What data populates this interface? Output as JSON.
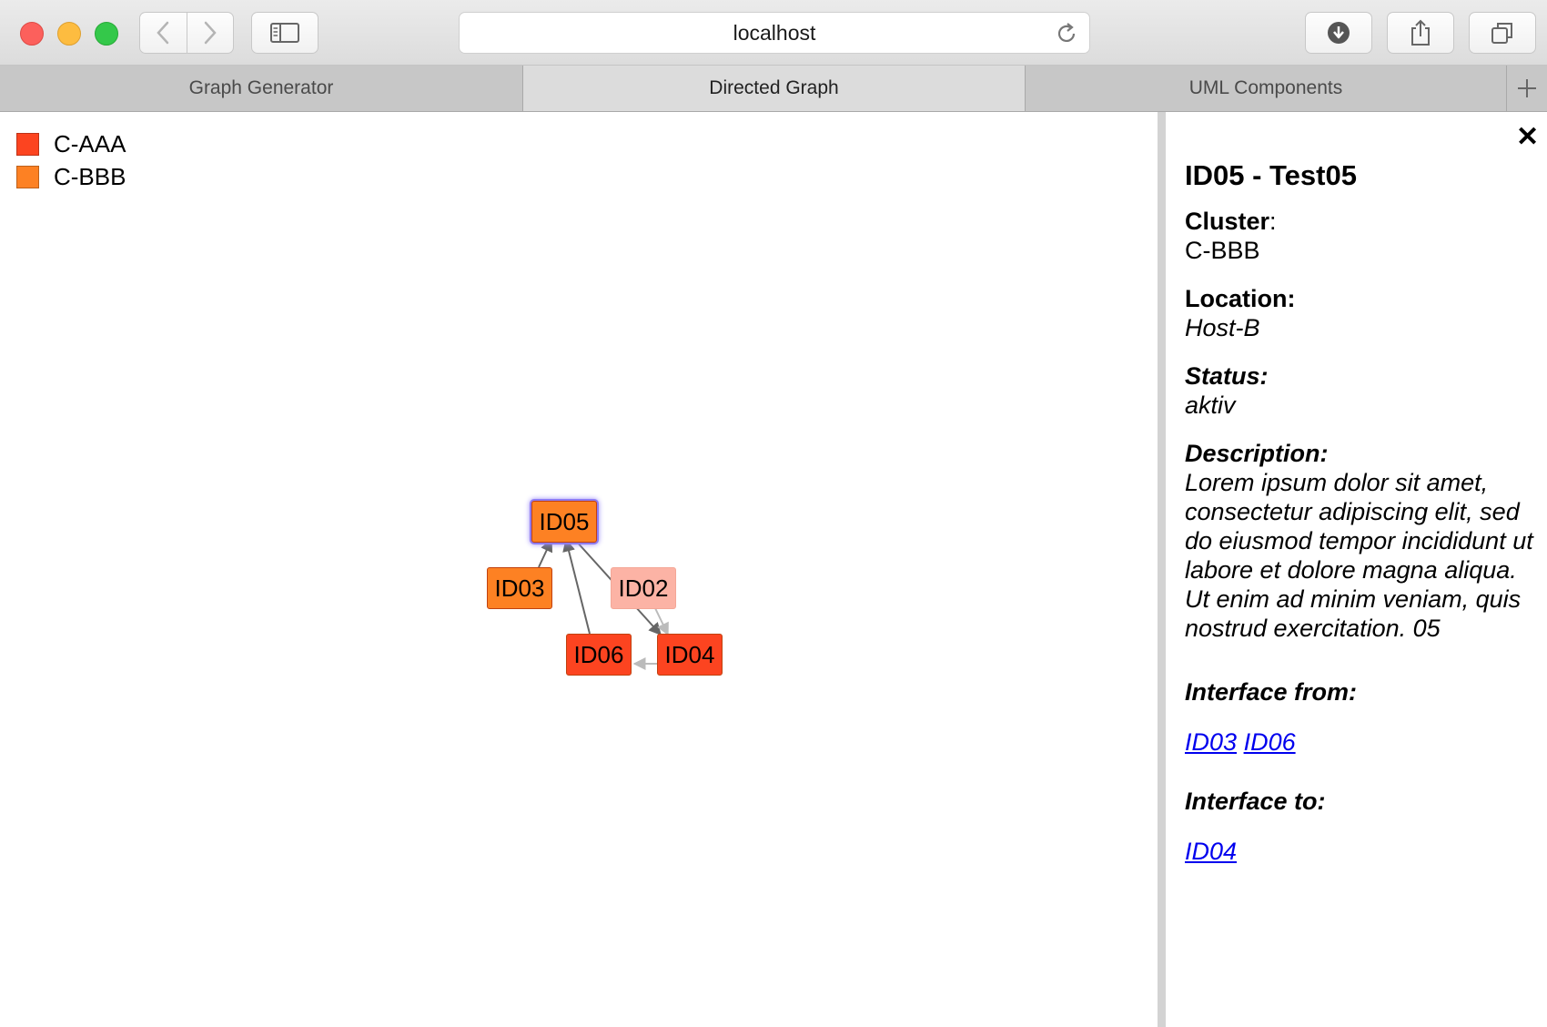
{
  "browser": {
    "url": "localhost",
    "tabs": [
      {
        "label": "Graph Generator",
        "active": false
      },
      {
        "label": "Directed Graph",
        "active": true
      },
      {
        "label": "UML Components",
        "active": false
      }
    ]
  },
  "legend": [
    {
      "label": "C-AAA",
      "color": "#fc4420"
    },
    {
      "label": "C-BBB",
      "color": "#fd8123"
    }
  ],
  "graph": {
    "nodes": [
      {
        "id": "ID05",
        "cluster": "C-BBB",
        "color": "#fd8123",
        "selected": true
      },
      {
        "id": "ID03",
        "cluster": "C-BBB",
        "color": "#fd8123",
        "selected": false
      },
      {
        "id": "ID02",
        "cluster": "C-AAA",
        "color": "#fcb3a5",
        "selected": false
      },
      {
        "id": "ID06",
        "cluster": "C-AAA",
        "color": "#fc4420",
        "selected": false
      },
      {
        "id": "ID04",
        "cluster": "C-AAA",
        "color": "#fc4420",
        "selected": false
      }
    ],
    "edges": [
      {
        "from": "ID03",
        "to": "ID05"
      },
      {
        "from": "ID06",
        "to": "ID05"
      },
      {
        "from": "ID05",
        "to": "ID04"
      },
      {
        "from": "ID02",
        "to": "ID04"
      },
      {
        "from": "ID04",
        "to": "ID06"
      }
    ]
  },
  "panel": {
    "close_label": "✕",
    "title": "ID05 - Test05",
    "cluster_label": "Cluster",
    "cluster_colon": ":",
    "cluster_value": "C-BBB",
    "location_label": "Location:",
    "location_value": "Host-B",
    "status_label": "Status:",
    "status_value": "aktiv",
    "description_label": "Description:",
    "description_value": "Lorem ipsum dolor sit amet, consectetur adipiscing elit, sed do eiusmod tempor incididunt ut labore et dolore magna aliqua. Ut enim ad minim veniam, quis nostrud exercitation. 05",
    "interface_from_label": "Interface from:",
    "interface_from": [
      "ID03",
      "ID06"
    ],
    "interface_to_label": "Interface to:",
    "interface_to": [
      "ID04"
    ]
  }
}
